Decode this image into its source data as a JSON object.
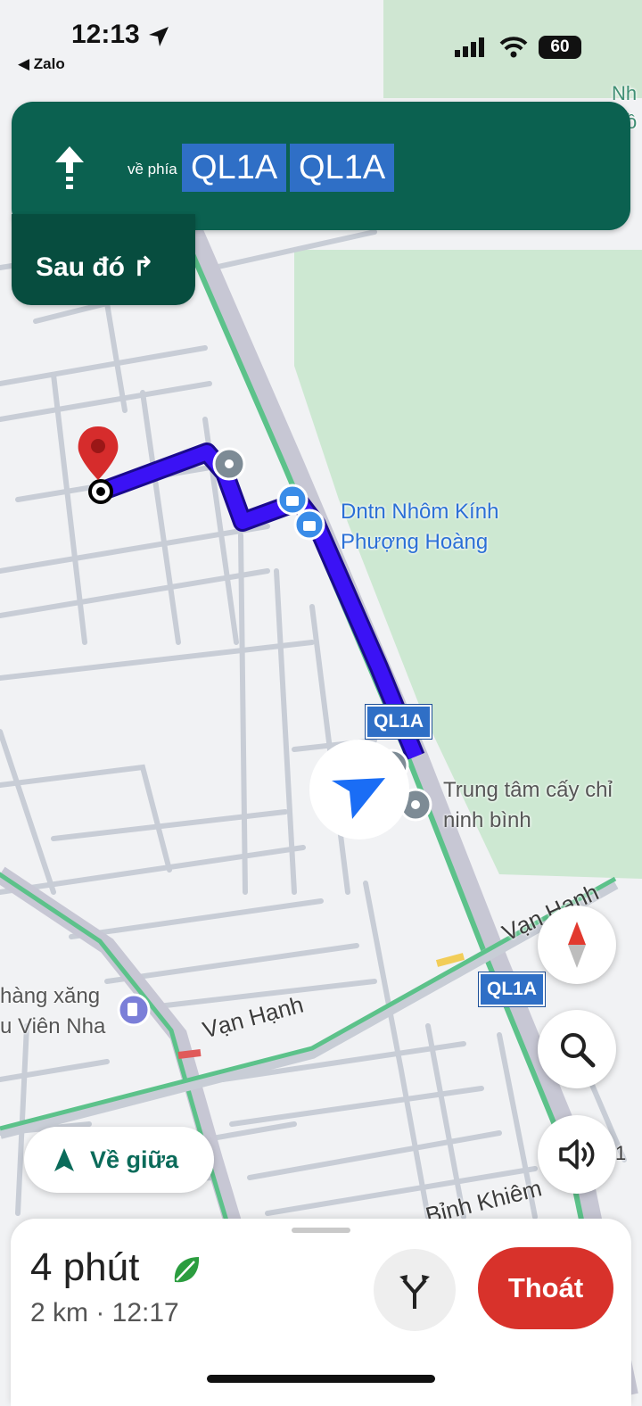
{
  "status_bar": {
    "time": "12:13",
    "back_app": "◀ Zalo",
    "battery": "60"
  },
  "nav_banner": {
    "toward_label": "về phía",
    "destinations": [
      "QL1A",
      "QL1A"
    ],
    "then_label": "Sau đó ↱"
  },
  "map": {
    "places": [
      {
        "name": "Dntn Nhôm Kính\nPhượng Hoàng"
      },
      {
        "name": "Trung tâm cấy chỉ\nninh bình"
      },
      {
        "name": "hàng xăng\nu Viên Nha"
      }
    ],
    "roads": [
      "Vạn Hạnh",
      "Vạn Hạnh",
      "Bỉnh Khiêm",
      "1"
    ],
    "shields": [
      "QL1A",
      "QL1A"
    ],
    "edge_text": [
      "Nh",
      "ồ"
    ],
    "colors": {
      "route": "#3b12f5",
      "park": "#cde8d2",
      "road": "#c8cdd6"
    }
  },
  "controls": {
    "recenter_label": "Về giữa",
    "compass_icon": "compass-icon",
    "search_icon": "search-icon",
    "sound_icon": "speaker-icon"
  },
  "trip": {
    "duration": "4 phút",
    "distance_eta": "2 km · 12:17",
    "exit_label": "Thoát"
  }
}
